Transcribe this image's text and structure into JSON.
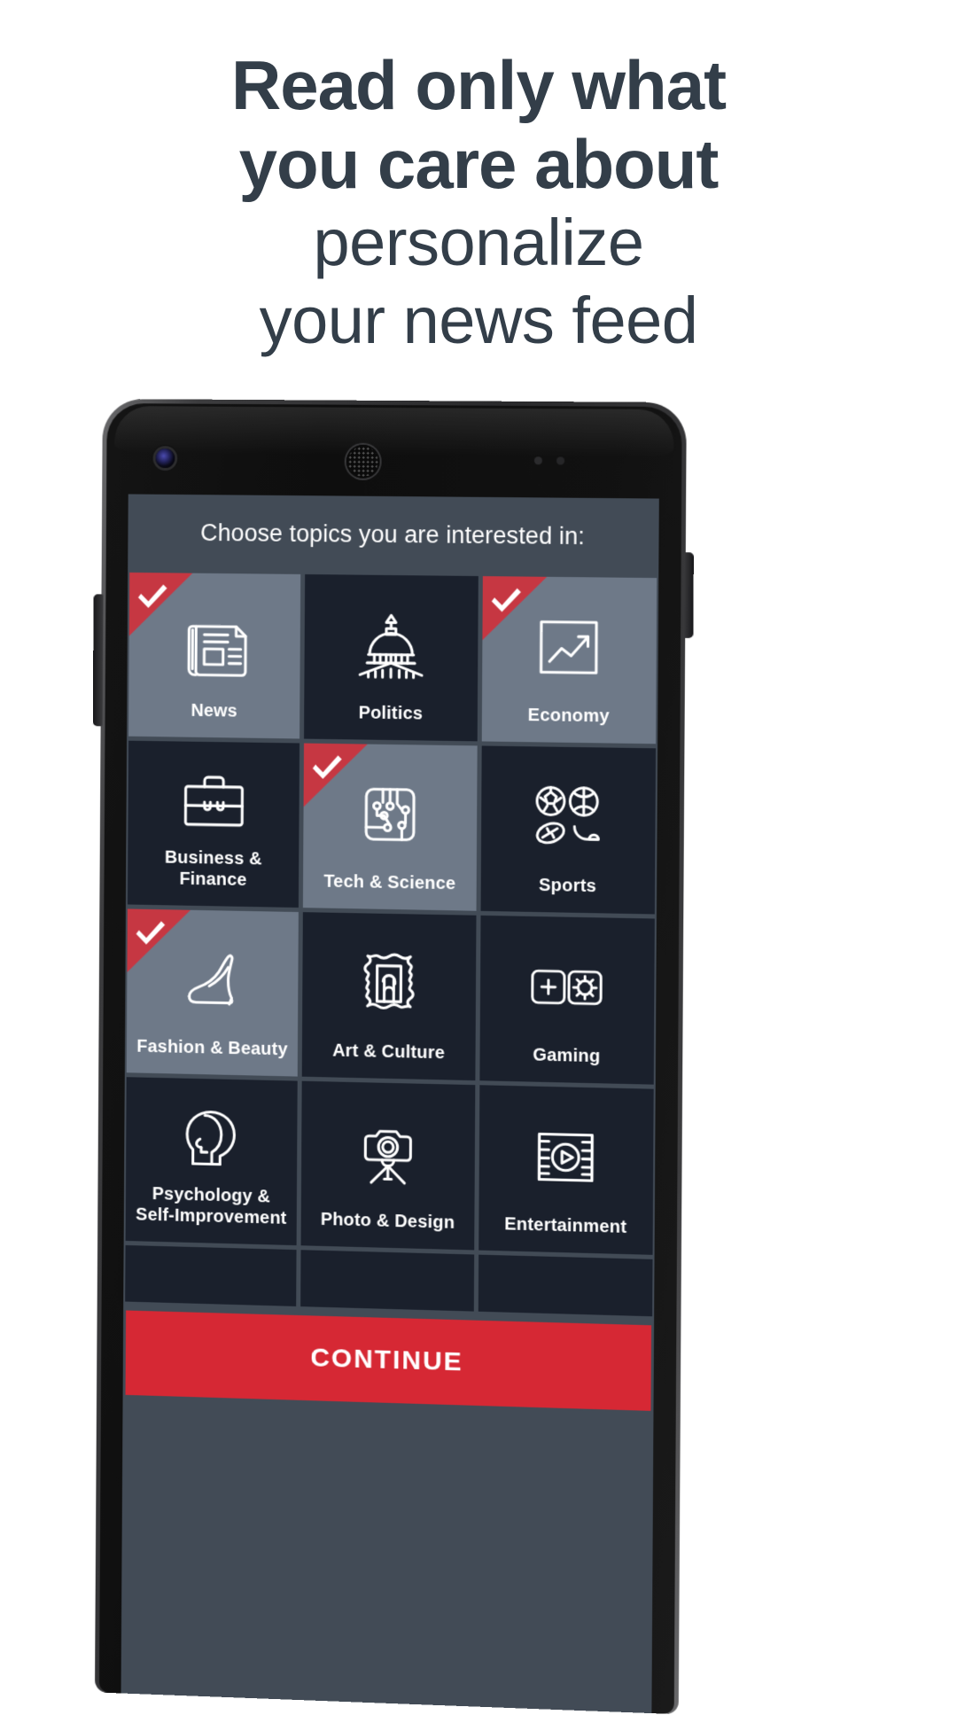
{
  "headline": {
    "line1": "Read only what",
    "line2": "you care about",
    "line3": "personalize",
    "line4": "your news feed"
  },
  "colors": {
    "headline_text": "#333e49",
    "screen_bg": "#424b56",
    "tile_unselected": "#1a202c",
    "tile_selected": "#6e7988",
    "accent_red": "#c63742",
    "continue_red": "#d62834",
    "label_text": "#ffffff"
  },
  "phone": {
    "camera_icon": "front-camera-icon",
    "earpiece_icon": "earpiece-speaker-icon",
    "power_button": "power-button",
    "volume_button": "volume-button"
  },
  "screen": {
    "title": "Choose topics you are interested in:",
    "continue_label": "CONTINUE"
  },
  "topics": [
    {
      "label": "News",
      "icon": "newspaper-icon",
      "selected": true
    },
    {
      "label": "Politics",
      "icon": "capitol-dome-icon",
      "selected": false
    },
    {
      "label": "Economy",
      "icon": "line-chart-icon",
      "selected": true
    },
    {
      "label": "Business & Finance",
      "icon": "briefcase-icon",
      "selected": false
    },
    {
      "label": "Tech & Science",
      "icon": "circuit-board-icon",
      "selected": true
    },
    {
      "label": "Sports",
      "icon": "sports-balls-icon",
      "selected": false
    },
    {
      "label": "Fashion & Beauty",
      "icon": "high-heel-shoe-icon",
      "selected": true
    },
    {
      "label": "Art & Culture",
      "icon": "picture-frame-icon",
      "selected": false
    },
    {
      "label": "Gaming",
      "icon": "gamepad-icon",
      "selected": false
    },
    {
      "label": "Psychology & Self-Improvement",
      "icon": "head-profile-icon",
      "selected": false
    },
    {
      "label": "Photo & Design",
      "icon": "camera-tripod-icon",
      "selected": false
    },
    {
      "label": "Entertainment",
      "icon": "film-play-icon",
      "selected": false
    }
  ],
  "partial_row_count": 3
}
